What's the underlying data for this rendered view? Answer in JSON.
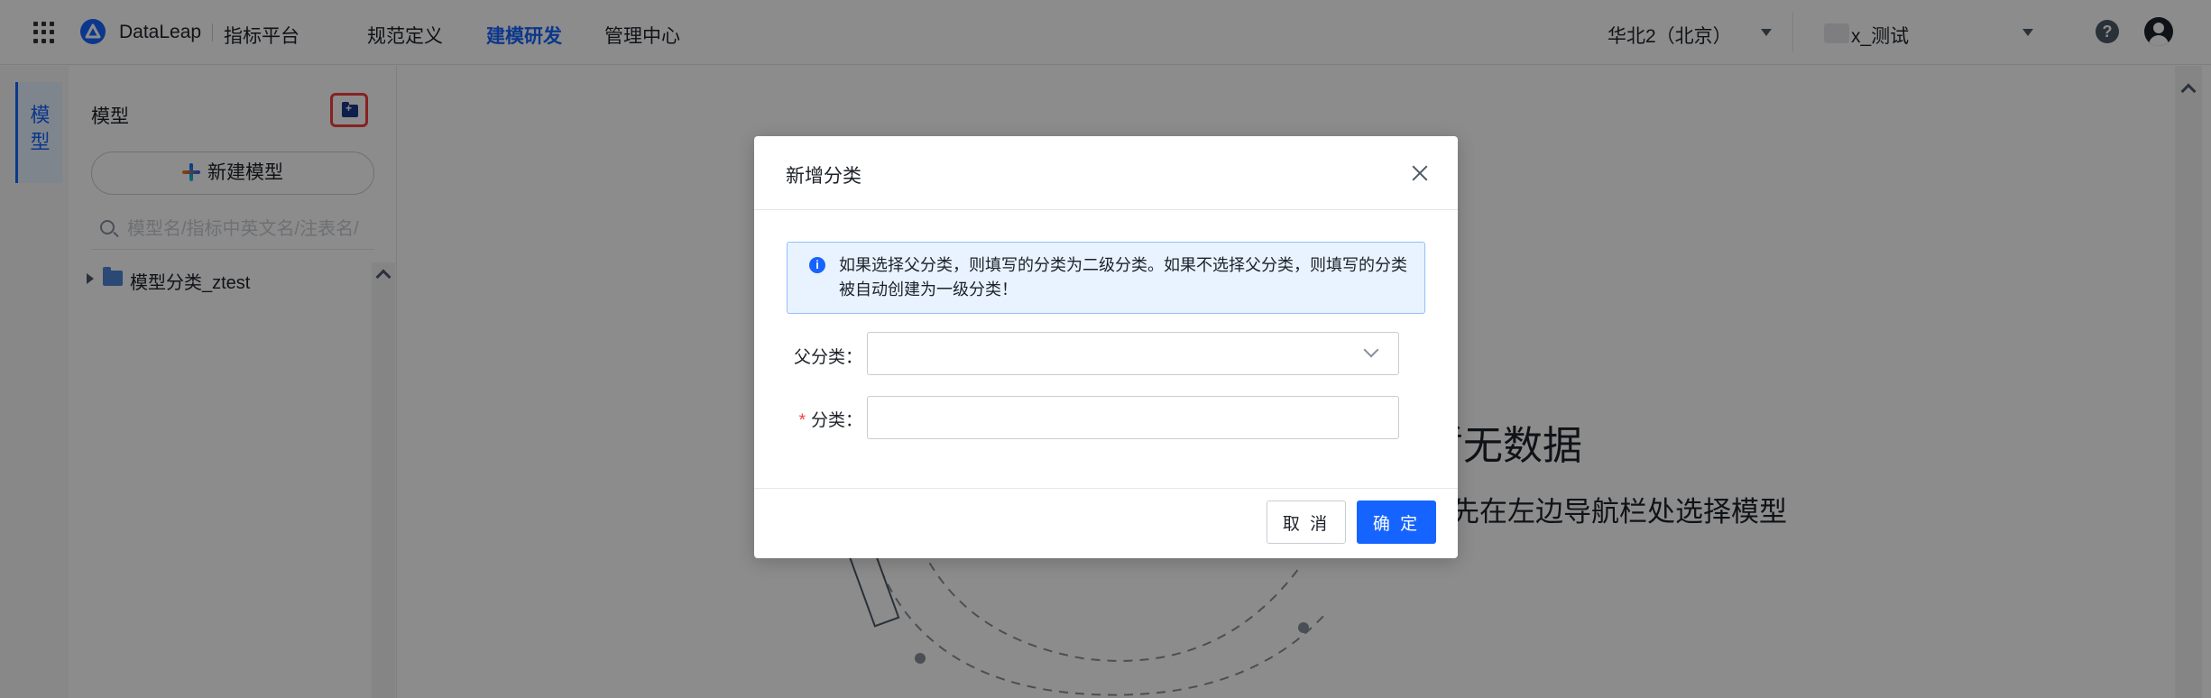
{
  "header": {
    "brand": "DataLeap",
    "product": "指标平台",
    "nav": [
      "规范定义",
      "建模研发",
      "管理中心"
    ],
    "active_nav": "建模研发",
    "region": "华北2（北京）",
    "project": "x_测试"
  },
  "rail": {
    "tab": "模型"
  },
  "sidebar": {
    "title": "模型",
    "new_model_label": "新建模型",
    "search_placeholder": "模型名/指标中英文名/注表名/",
    "tree": [
      {
        "label": "模型分类_ztest"
      }
    ]
  },
  "main": {
    "empty_title": "暂无数据",
    "empty_subtitle": "请先在左边导航栏处选择模型"
  },
  "dialog": {
    "title": "新增分类",
    "alert": "如果选择父分类，则填写的分类为二级分类。如果不选择父分类，则填写的分类被自动创建为一级分类！",
    "parent_label": "父分类：",
    "parent_value": "",
    "category_required": "*",
    "category_label": "分类：",
    "category_value": "",
    "cancel_label": "取 消",
    "ok_label": "确 定"
  },
  "colors": {
    "primary": "#1664ff",
    "danger": "#f53f3f",
    "mask": "rgba(0,0,0,0.45)"
  }
}
